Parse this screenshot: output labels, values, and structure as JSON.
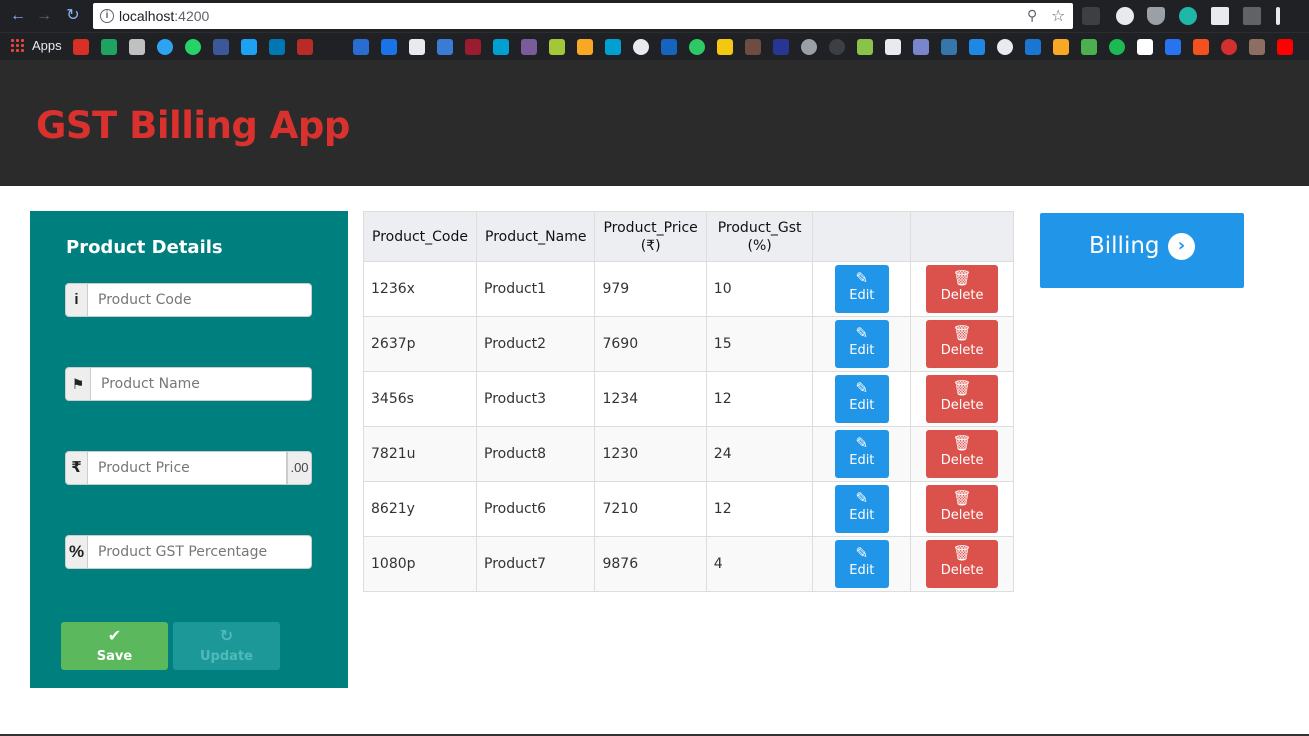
{
  "browser": {
    "url_host": "localhost",
    "url_port": ":4200",
    "bookmarks_apps_label": "Apps"
  },
  "header": {
    "title": "GST Billing App"
  },
  "form": {
    "title": "Product Details",
    "code_placeholder": "Product Code",
    "name_placeholder": "Product Name",
    "price_placeholder": "Product Price",
    "price_suffix": ".00",
    "gst_placeholder": "Product GST Percentage",
    "save_label": "Save",
    "update_label": "Update"
  },
  "table": {
    "headers": [
      "Product_Code",
      "Product_Name",
      "Product_Price (₹)",
      "Product_Gst (%)"
    ],
    "edit_label": "Edit",
    "delete_label": "Delete",
    "rows": [
      {
        "code": "1236x",
        "name": "Product1",
        "price": "979",
        "gst": "10"
      },
      {
        "code": "2637p",
        "name": "Product2",
        "price": "7690",
        "gst": "15"
      },
      {
        "code": "3456s",
        "name": "Product3",
        "price": "1234",
        "gst": "12"
      },
      {
        "code": "7821u",
        "name": "Product8",
        "price": "1230",
        "gst": "24"
      },
      {
        "code": "8621y",
        "name": "Product6",
        "price": "7210",
        "gst": "12"
      },
      {
        "code": "1080p",
        "name": "Product7",
        "price": "9876",
        "gst": "4"
      }
    ]
  },
  "billing": {
    "label": "Billing"
  },
  "colors": {
    "header_bg": "#2b2b2b",
    "title_red": "#d9322e",
    "panel_teal": "#007f7f",
    "save_green": "#5cb85c",
    "edit_blue": "#2196e8",
    "delete_red": "#db524d"
  }
}
